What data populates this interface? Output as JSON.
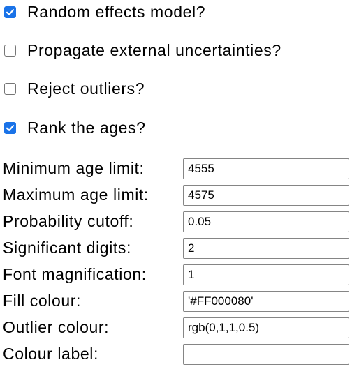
{
  "checkboxes": [
    {
      "label": "Random effects model?",
      "checked": true
    },
    {
      "label": "Propagate external uncertainties?",
      "checked": false
    },
    {
      "label": "Reject outliers?",
      "checked": false
    },
    {
      "label": "Rank the ages?",
      "checked": true
    }
  ],
  "fields": [
    {
      "label": "Minimum age limit:",
      "value": "4555"
    },
    {
      "label": "Maximum age limit:",
      "value": "4575"
    },
    {
      "label": "Probability cutoff:",
      "value": "0.05"
    },
    {
      "label": "Significant digits:",
      "value": "2"
    },
    {
      "label": "Font magnification:",
      "value": "1"
    },
    {
      "label": "Fill colour:",
      "value": "'#FF000080'"
    },
    {
      "label": "Outlier colour:",
      "value": "rgb(0,1,1,0.5)"
    },
    {
      "label": "Colour label:",
      "value": ""
    }
  ],
  "colors": {
    "checkbox_checked": "#1a73e8",
    "input_border": "#858585"
  }
}
